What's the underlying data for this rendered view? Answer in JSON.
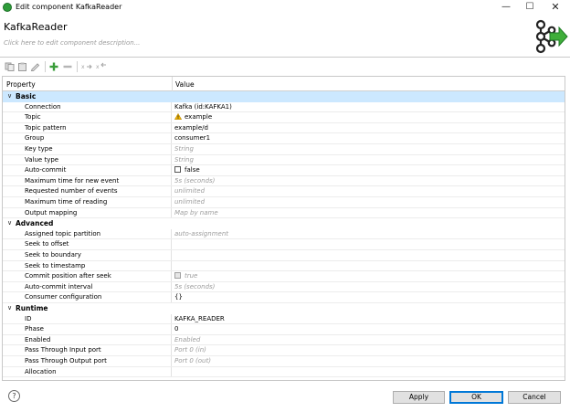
{
  "window": {
    "title": "Edit component KafkaReader",
    "min_glyph": "—",
    "max_glyph": "☐",
    "close_glyph": "✕"
  },
  "header": {
    "component_name": "KafkaReader",
    "description_hint": "Click here to edit component description..."
  },
  "toolbar": {
    "icons": [
      "copy-icon",
      "paste-icon",
      "edit-icon",
      "add-icon",
      "remove-icon",
      "move-right-icon",
      "move-left-icon"
    ]
  },
  "table": {
    "col_property": "Property",
    "col_value": "Value",
    "groups": [
      {
        "label": "Basic",
        "rows": [
          {
            "name": "Connection",
            "value": "Kafka (id:KAFKA1)",
            "style": "normal"
          },
          {
            "name": "Topic",
            "value": "example",
            "style": "warning"
          },
          {
            "name": "Topic pattern",
            "value": "example/d",
            "style": "normal"
          },
          {
            "name": "Group",
            "value": "consumer1",
            "style": "normal"
          },
          {
            "name": "Key type",
            "value": "String",
            "style": "default"
          },
          {
            "name": "Value type",
            "value": "String",
            "style": "default"
          },
          {
            "name": "Auto-commit",
            "value": "false",
            "style": "checkbox"
          },
          {
            "name": "Maximum time for new event",
            "value": "5s (seconds)",
            "style": "default"
          },
          {
            "name": "Requested number of events",
            "value": "unlimited",
            "style": "default"
          },
          {
            "name": "Maximum time of reading",
            "value": "unlimited",
            "style": "default"
          },
          {
            "name": "Output mapping",
            "value": "Map by name",
            "style": "default"
          }
        ]
      },
      {
        "label": "Advanced",
        "rows": [
          {
            "name": "Assigned topic partition",
            "value": "auto-assignment",
            "style": "default"
          },
          {
            "name": "Seek to offset",
            "value": "",
            "style": "normal"
          },
          {
            "name": "Seek to boundary",
            "value": "",
            "style": "normal"
          },
          {
            "name": "Seek to timestamp",
            "value": "",
            "style": "normal"
          },
          {
            "name": "Commit position after seek",
            "value": "true",
            "style": "checkbox-disabled"
          },
          {
            "name": "Auto-commit interval",
            "value": "5s (seconds)",
            "style": "default"
          },
          {
            "name": "Consumer configuration",
            "value": "{}",
            "style": "normal"
          }
        ]
      },
      {
        "label": "Runtime",
        "rows": [
          {
            "name": "ID",
            "value": "KAFKA_READER",
            "style": "normal"
          },
          {
            "name": "Phase",
            "value": "0",
            "style": "normal"
          },
          {
            "name": "Enabled",
            "value": "Enabled",
            "style": "default"
          },
          {
            "name": "Pass Through Input port",
            "value": "Port 0 (in)",
            "style": "default"
          },
          {
            "name": "Pass Through Output port",
            "value": "Port 0 (out)",
            "style": "default"
          },
          {
            "name": "Allocation",
            "value": "",
            "style": "normal"
          }
        ]
      }
    ]
  },
  "footer": {
    "help_glyph": "?",
    "apply_label": "Apply",
    "ok_label": "OK",
    "cancel_label": "Cancel"
  },
  "colors": {
    "selection": "#cce8ff",
    "brand_green": "#2e9c3a",
    "warning": "#f0b400"
  }
}
